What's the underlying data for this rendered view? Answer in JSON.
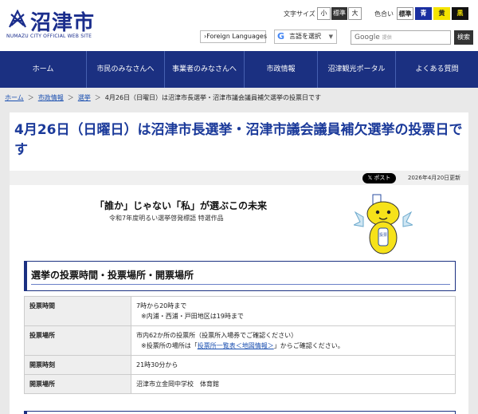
{
  "header": {
    "logo_text": "沼津市",
    "logo_sub": "NUMAZU CITY OFFICIAL WEB SITE",
    "text_size_label": "文字サイズ",
    "text_sizes": [
      "小",
      "標準",
      "大"
    ],
    "color_label": "色合い",
    "colors": [
      {
        "label": "標準",
        "bg": "#ffffff",
        "fg": "#222222"
      },
      {
        "label": "青",
        "bg": "#1a2fa0",
        "fg": "#ffffff"
      },
      {
        "label": "黄",
        "bg": "#f5e400",
        "fg": "#222222"
      },
      {
        "label": "黒",
        "bg": "#111111",
        "fg": "#f5e400"
      }
    ],
    "foreign_languages": "›Foreign Languages",
    "translate_label": "言語を選択",
    "search_placeholder": "Google",
    "search_by": "提供",
    "search_button": "検索"
  },
  "nav": {
    "items": [
      "ホーム",
      "市民のみなさんへ",
      "事業者のみなさんへ",
      "市政情報",
      "沼津観光ポータル",
      "よくある質問"
    ]
  },
  "breadcrumb": {
    "home": "ホーム",
    "level1": "市政情報",
    "level2": "選挙",
    "current": "4月26日（日曜日）は沼津市長選挙・沼津市議会議員補欠選挙の投票日です",
    "separator": "＞"
  },
  "article": {
    "title": "4月26日（日曜日）は沼津市長選挙・沼津市議会議員補欠選挙の投票日です",
    "post_button": "ポスト",
    "updated": "2026年4月20日更新",
    "slogan": "「誰か」じゃない「私」が選ぶこの未来",
    "slogan_sub": "令和7年度明るい選挙啓発標語 特選作品",
    "mascot_label": "投票",
    "section_title": "選挙の投票時間・投票場所・開票場所",
    "table": [
      {
        "header": "投票時間",
        "line1": "7時から20時まで",
        "line2": "※内浦・西浦・戸田地区は19時まで"
      },
      {
        "header": "投票場所",
        "line1": "市内62か所の投票所（投票所入場券でご確認ください）",
        "line2_pre": "※投票所の場所は「",
        "line2_link": "投票所一覧表＜地図情報＞",
        "line2_post": "」からご確認ください。"
      },
      {
        "header": "開票時刻",
        "line1": "21時30分から"
      },
      {
        "header": "開票場所",
        "line1": "沼津市立金岡中学校　体育館"
      }
    ]
  }
}
